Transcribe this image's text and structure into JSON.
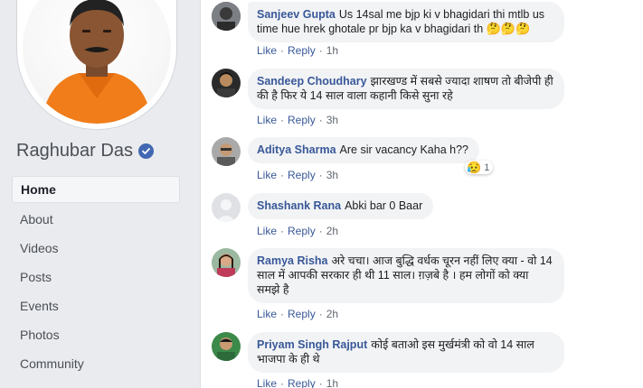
{
  "page": {
    "name": "Raghubar Das",
    "nav": [
      {
        "label": "Home",
        "active": true
      },
      {
        "label": "About"
      },
      {
        "label": "Videos"
      },
      {
        "label": "Posts"
      },
      {
        "label": "Events"
      },
      {
        "label": "Photos"
      },
      {
        "label": "Community"
      }
    ]
  },
  "comments": [
    {
      "author": "Sanjeev Gupta",
      "text": "Us 14sal me bjp ki v bhagidari thi mtlb us time hue hrek ghotale pr bjp ka v bhagidari th",
      "emojis": "🤔🤔🤔",
      "like": "Like",
      "reply": "Reply",
      "time": "1h"
    },
    {
      "author": "Sandeep Choudhary",
      "text": "झारखण्ड में सबसे ज्यादा शाषण तो बीजेपी ही की है फिर ये 14 साल वाला कहानी किसे सुना रहे",
      "like": "Like",
      "reply": "Reply",
      "time": "3h"
    },
    {
      "author": "Aditya Sharma",
      "text": "Are sir vacancy Kaha h??",
      "like": "Like",
      "reply": "Reply",
      "time": "3h",
      "reaction_count": "1"
    },
    {
      "author": "Shashank Rana",
      "text": "Abki bar 0 Baar",
      "like": "Like",
      "reply": "Reply",
      "time": "2h"
    },
    {
      "author": "Ramya Risha",
      "text": "अरे चचा। आज बुद्धि वर्धक चूरन नहीं लिए क्या - वो 14 साल में आपकी सरकार ही थी 11 साल। ग़ज़बे है । हम लोगों को क्या समझे है",
      "like": "Like",
      "reply": "Reply",
      "time": "2h"
    },
    {
      "author": "Priyam Singh Rajput",
      "text": "कोई बताओ इस मुर्खमंत्री को वो 14 साल भाजपा के ही थे",
      "like": "Like",
      "reply": "Reply",
      "time": "1h"
    }
  ]
}
